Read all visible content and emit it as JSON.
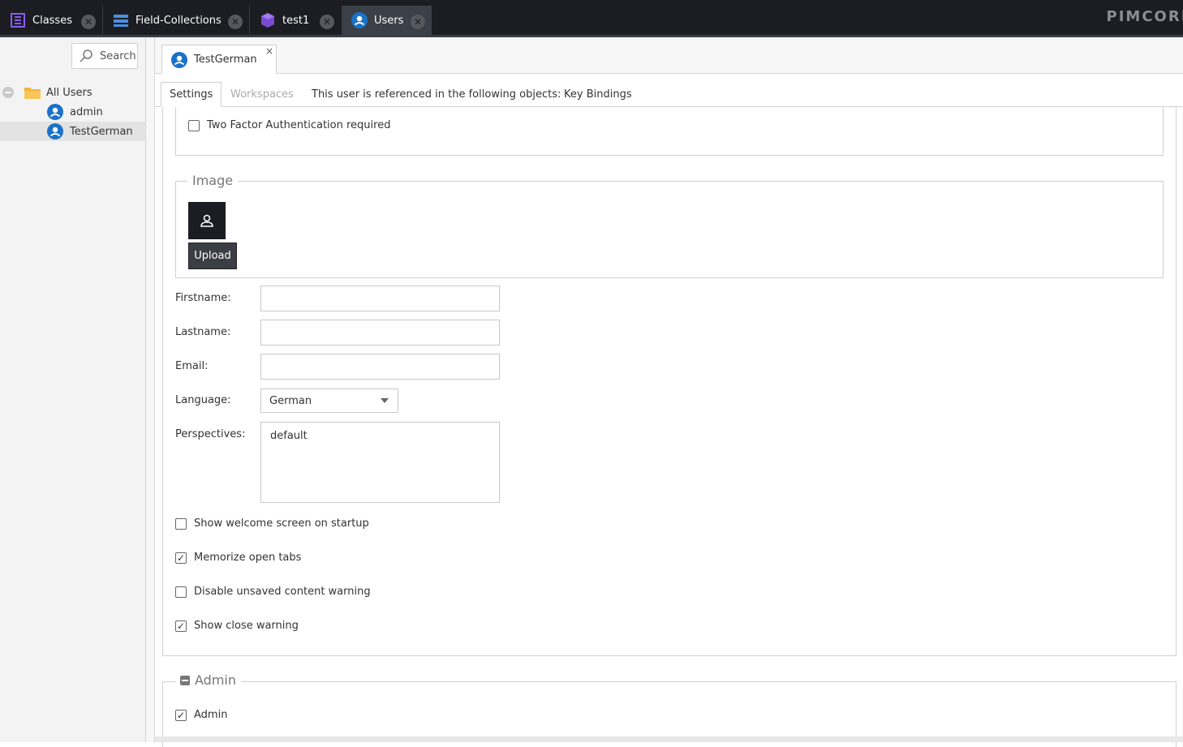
{
  "app": {
    "brand": "PIMCORE",
    "top_tabs": [
      {
        "label": "Classes",
        "icon": "classes-icon"
      },
      {
        "label": "Field-Collections",
        "icon": "field-collections-icon"
      },
      {
        "label": "test1",
        "icon": "cube-icon"
      },
      {
        "label": "Users",
        "icon": "user-icon",
        "active": true
      }
    ]
  },
  "sidebar": {
    "search_label": "Search",
    "tree": [
      {
        "label": "All Users",
        "type": "folder"
      },
      {
        "label": "admin",
        "type": "user"
      },
      {
        "label": "TestGerman",
        "type": "user",
        "selected": true
      }
    ]
  },
  "editor": {
    "user_tab_label": "TestGerman",
    "close_glyph": "×",
    "subtabs": [
      {
        "label": "Settings",
        "active": true
      },
      {
        "label": "Workspaces",
        "disabled": true
      },
      {
        "label": "This user is referenced in the following objects:"
      },
      {
        "label": "Key Bindings"
      }
    ]
  },
  "form": {
    "two_factor": {
      "label": "Two Factor Authentication required",
      "checked": false
    },
    "image": {
      "legend": "Image",
      "upload_label": "Upload"
    },
    "firstname": {
      "label": "Firstname:",
      "value": ""
    },
    "lastname": {
      "label": "Lastname:",
      "value": ""
    },
    "email": {
      "label": "Email:",
      "value": ""
    },
    "language": {
      "label": "Language:",
      "value": "German"
    },
    "perspectives": {
      "label": "Perspectives:",
      "value": "default"
    },
    "checkboxes": [
      {
        "label": "Show welcome screen on startup",
        "checked": false
      },
      {
        "label": "Memorize open tabs",
        "checked": true
      },
      {
        "label": "Disable unsaved content warning",
        "checked": false
      },
      {
        "label": "Show close warning",
        "checked": true
      }
    ],
    "admin": {
      "legend": "Admin",
      "checkbox_label": "Admin",
      "checked": true
    }
  },
  "colors": {
    "accent": "#1a72c9",
    "topbar": "#1b1d22",
    "purple": "#7a4bd1"
  }
}
